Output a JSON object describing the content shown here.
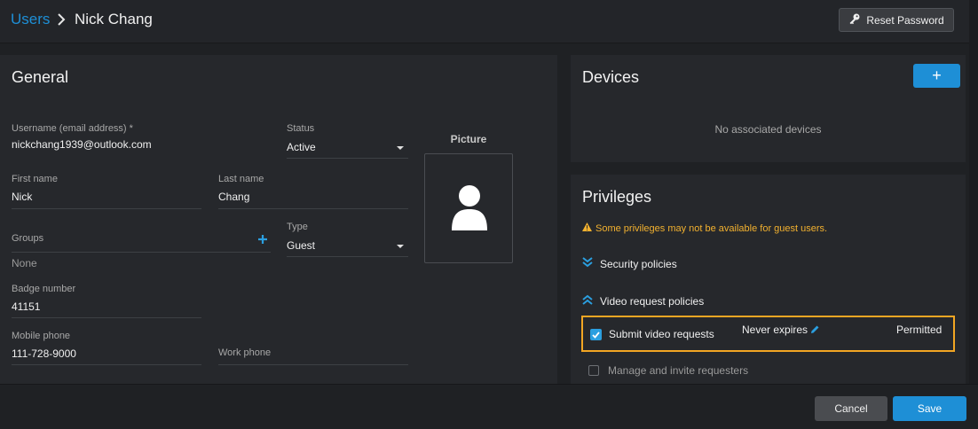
{
  "breadcrumb": {
    "parent": "Users",
    "current": "Nick Chang"
  },
  "header": {
    "reset_password_label": "Reset Password"
  },
  "general": {
    "title": "General",
    "username": {
      "label": "Username (email address) *",
      "value": "nickchang1939@outlook.com"
    },
    "status": {
      "label": "Status",
      "value": "Active"
    },
    "first_name": {
      "label": "First name",
      "value": "Nick"
    },
    "last_name": {
      "label": "Last name",
      "value": "Chang"
    },
    "groups": {
      "label": "Groups",
      "value": "None"
    },
    "type": {
      "label": "Type",
      "value": "Guest"
    },
    "badge_number": {
      "label": "Badge number",
      "value": "41151"
    },
    "mobile_phone": {
      "label": "Mobile phone",
      "value": "111-728-9000"
    },
    "work_phone": {
      "label": "Work phone",
      "value": ""
    },
    "picture_label": "Picture"
  },
  "devices": {
    "title": "Devices",
    "empty_text": "No associated devices",
    "add_label": "+"
  },
  "privileges": {
    "title": "Privileges",
    "warning": "Some privileges may not be available for guest users.",
    "security_policies": "Security policies",
    "video_request_policies": "Video request policies",
    "submit_video_requests": {
      "label": "Submit video requests",
      "expiry": "Never expires",
      "state": "Permitted",
      "checked": true
    },
    "manage_invite": {
      "label": "Manage and invite requesters",
      "checked": false
    }
  },
  "footer": {
    "cancel_label": "Cancel",
    "save_label": "Save"
  },
  "colors": {
    "accent": "#1e8fd6",
    "warning": "#f2b12f",
    "highlight": "#f2a623"
  }
}
